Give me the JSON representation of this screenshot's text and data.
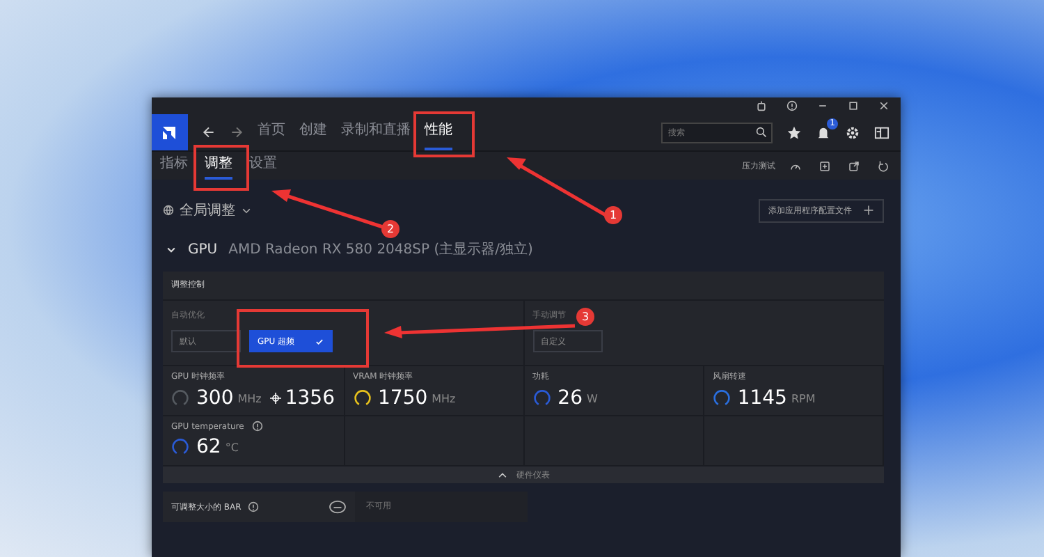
{
  "nav": {
    "tabs": [
      {
        "label": "首页",
        "selected": false
      },
      {
        "label": "创建",
        "selected": false
      },
      {
        "label": "录制和直播",
        "selected": false
      },
      {
        "label": "性能",
        "selected": true
      }
    ],
    "search": {
      "placeholder": "搜索"
    },
    "notification_badge": "1"
  },
  "subtabs": {
    "tabs": [
      {
        "label": "指标",
        "selected": false
      },
      {
        "label": "调整",
        "selected": true
      },
      {
        "label": "设置",
        "selected": false
      }
    ],
    "stress_test": "压力测试"
  },
  "scope": "全局调整",
  "add_profile": "添加应用程序配置文件",
  "gpu": {
    "label": "GPU",
    "name": "AMD Radeon RX 580 2048SP (主显示器/独立)"
  },
  "tuning": {
    "title": "调整控制",
    "auto_label": "自动优化",
    "options": [
      {
        "label": "默认",
        "selected": false
      },
      {
        "label": "GPU 超频",
        "selected": true
      }
    ],
    "manual_label": "手动调节",
    "manual_option": "自定义"
  },
  "metrics": [
    {
      "label": "GPU 时钟频率",
      "value": "300",
      "unit": "MHz",
      "extra": "1356",
      "color": "#555a60"
    },
    {
      "label": "VRAM 时钟频率",
      "value": "1750",
      "unit": "MHz",
      "color": "#e8c21c"
    },
    {
      "label": "功耗",
      "value": "26",
      "unit": "W",
      "color": "#2a5bd7"
    },
    {
      "label": "风扇转速",
      "value": "1145",
      "unit": "RPM",
      "color": "#2a6fe0"
    },
    {
      "label": "GPU temperature",
      "value": "62",
      "unit": "°C",
      "color": "#2a5bd7",
      "help": true
    }
  ],
  "hardware_toggle": "硬件仪表",
  "bar": {
    "label": "可调整大小的 BAR",
    "value": "不可用"
  },
  "annotations": [
    "1",
    "2",
    "3"
  ]
}
